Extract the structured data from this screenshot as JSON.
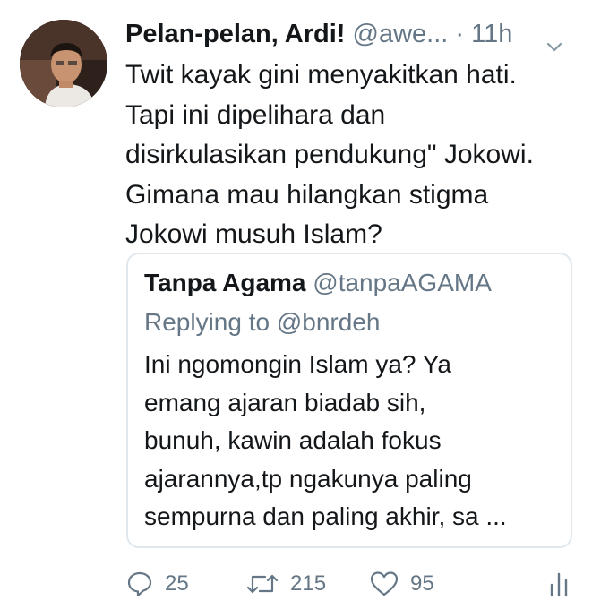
{
  "tweet": {
    "display_name": "Pelan-pelan, Ardi!",
    "handle": "@awe...",
    "separator": "·",
    "time": "11h",
    "text_lines": [
      "Twit kayak gini menyakitkan hati.",
      "Tapi ini dipelihara dan",
      "disirkulasikan pendukung\" Jokowi.",
      "Gimana mau hilangkan stigma",
      "Jokowi musuh Islam?"
    ]
  },
  "quoted_tweet": {
    "display_name": "Tanpa Agama",
    "handle": "@tanpaAGAMA",
    "replying_to": "Replying to @bnrdeh",
    "text_lines": [
      "Ini ngomongin Islam ya? Ya",
      "emang ajaran biadab sih,",
      "bunuh, kawin adalah fokus",
      "ajarannya,tp ngakunya paling",
      "sempurna dan paling akhir, sa ..."
    ]
  },
  "actions": {
    "reply_count": "25",
    "retweet_count": "215",
    "like_count": "95"
  },
  "icons": {
    "menu": "chevron-down-icon",
    "reply": "reply-icon",
    "retweet": "retweet-icon",
    "like": "heart-icon",
    "analytics": "analytics-icon"
  },
  "colors": {
    "text": "#14171a",
    "secondary": "#657786",
    "border": "#e1e8ed",
    "background": "#ffffff"
  }
}
